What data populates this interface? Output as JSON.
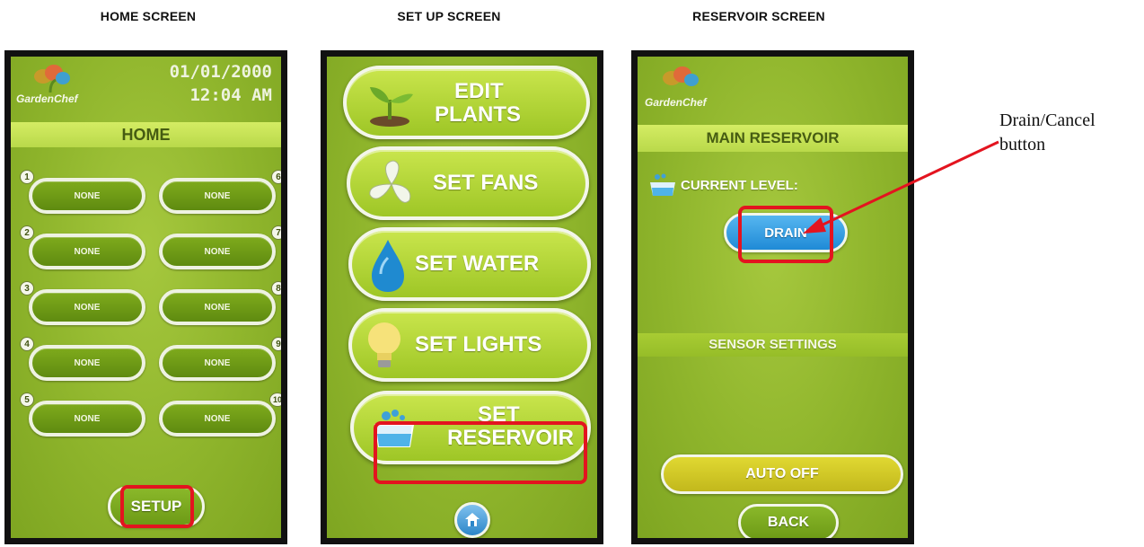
{
  "captions": {
    "home": "HOME SCREEN",
    "setup": "SET UP SCREEN",
    "reservoir": "RESERVOIR SCREEN"
  },
  "home_screen": {
    "brand": "GardenChef",
    "date": "01/01/2000",
    "time": "12:04 AM",
    "title": "HOME",
    "slots": [
      {
        "number": "1",
        "label": "NONE"
      },
      {
        "number": "2",
        "label": "NONE"
      },
      {
        "number": "3",
        "label": "NONE"
      },
      {
        "number": "4",
        "label": "NONE"
      },
      {
        "number": "5",
        "label": "NONE"
      },
      {
        "number": "6",
        "label": "NONE"
      },
      {
        "number": "7",
        "label": "NONE"
      },
      {
        "number": "8",
        "label": "NONE"
      },
      {
        "number": "9",
        "label": "NONE"
      },
      {
        "number": "10",
        "label": "NONE"
      }
    ],
    "setup_button": "SETUP"
  },
  "setup_screen": {
    "edit_plants_line1": "EDIT",
    "edit_plants_line2": "PLANTS",
    "set_fans": "SET FANS",
    "set_water": "SET WATER",
    "set_lights": "SET LIGHTS",
    "set_reservoir_line1": "SET",
    "set_reservoir_line2": "RESERVOIR"
  },
  "reservoir_screen": {
    "brand": "GardenChef",
    "title": "MAIN RESERVOIR",
    "current_level_label": "CURRENT LEVEL:",
    "drain_button": "DRAIN",
    "sensor_settings": "SENSOR SETTINGS",
    "auto_off_button": "AUTO OFF",
    "back_button": "BACK"
  },
  "annotation": {
    "line1": "Drain/Cancel",
    "line2": "button"
  },
  "colors": {
    "highlight": "#e3141f",
    "drain_blue": "#2a9ce0",
    "screen_green": "#8fb52c"
  },
  "icons": [
    "gardenchef-logo-icon",
    "sprout-icon",
    "fan-icon",
    "water-drop-icon",
    "light-bulb-icon",
    "reservoir-icon",
    "home-icon",
    "water-level-icon",
    "arrow-icon"
  ]
}
